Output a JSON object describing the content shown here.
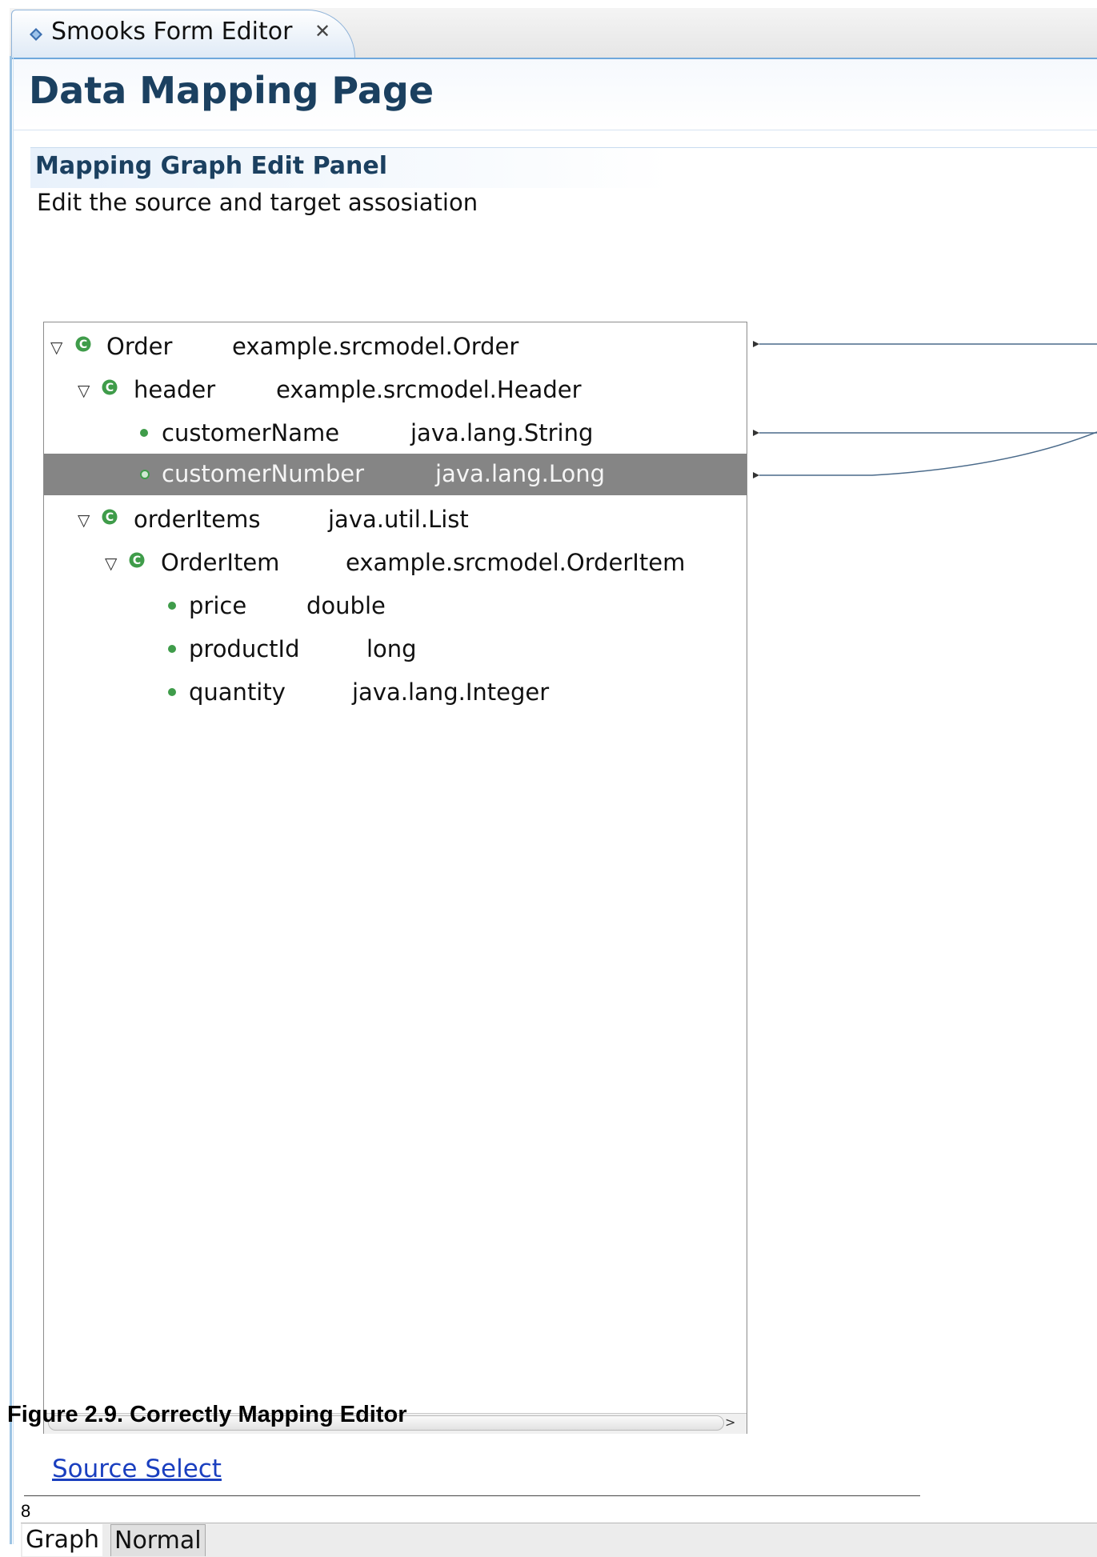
{
  "editor_tab": {
    "label": "Smooks Form Editor",
    "close_glyph": "✕"
  },
  "page": {
    "title": "Data Mapping Page"
  },
  "section": {
    "title": "Mapping Graph Edit Panel",
    "description": "Edit the source and target assosiation"
  },
  "tree": {
    "rows": [
      {
        "name": "Order",
        "type": "example.srcmodel.Order",
        "kind": "class",
        "expanded": true,
        "level": 0,
        "selected": false
      },
      {
        "name": "header",
        "type": "example.srcmodel.Header",
        "kind": "class",
        "expanded": true,
        "level": 1,
        "selected": false
      },
      {
        "name": "customerName",
        "type": "java.lang.String",
        "kind": "field",
        "level": 2,
        "selected": false
      },
      {
        "name": "customerNumber",
        "type": "java.lang.Long",
        "kind": "field",
        "level": 2,
        "selected": true
      },
      {
        "name": "orderItems",
        "type": "java.util.List",
        "kind": "class",
        "expanded": true,
        "level": 1,
        "selected": false
      },
      {
        "name": "OrderItem",
        "type": "example.srcmodel.OrderItem",
        "kind": "class",
        "expanded": true,
        "level": 2,
        "selected": false
      },
      {
        "name": "price",
        "type": "double",
        "kind": "field",
        "level": 3,
        "selected": false
      },
      {
        "name": "productId",
        "type": "long",
        "kind": "field",
        "level": 3,
        "selected": false
      },
      {
        "name": "quantity",
        "type": "java.lang.Integer",
        "kind": "field",
        "level": 3,
        "selected": false
      }
    ]
  },
  "caption": "Figure 2.9. Correctly Mapping Editor",
  "source_select_link": "Source Select",
  "page_number": "8",
  "bottom_tabs": [
    {
      "label": "Graph",
      "active": true
    },
    {
      "label": "Normal",
      "active": false
    }
  ],
  "colors": {
    "accent": "#1b4060",
    "selection": "#858585",
    "icon_green": "#3f9c4a",
    "link": "#1a3fbf"
  }
}
